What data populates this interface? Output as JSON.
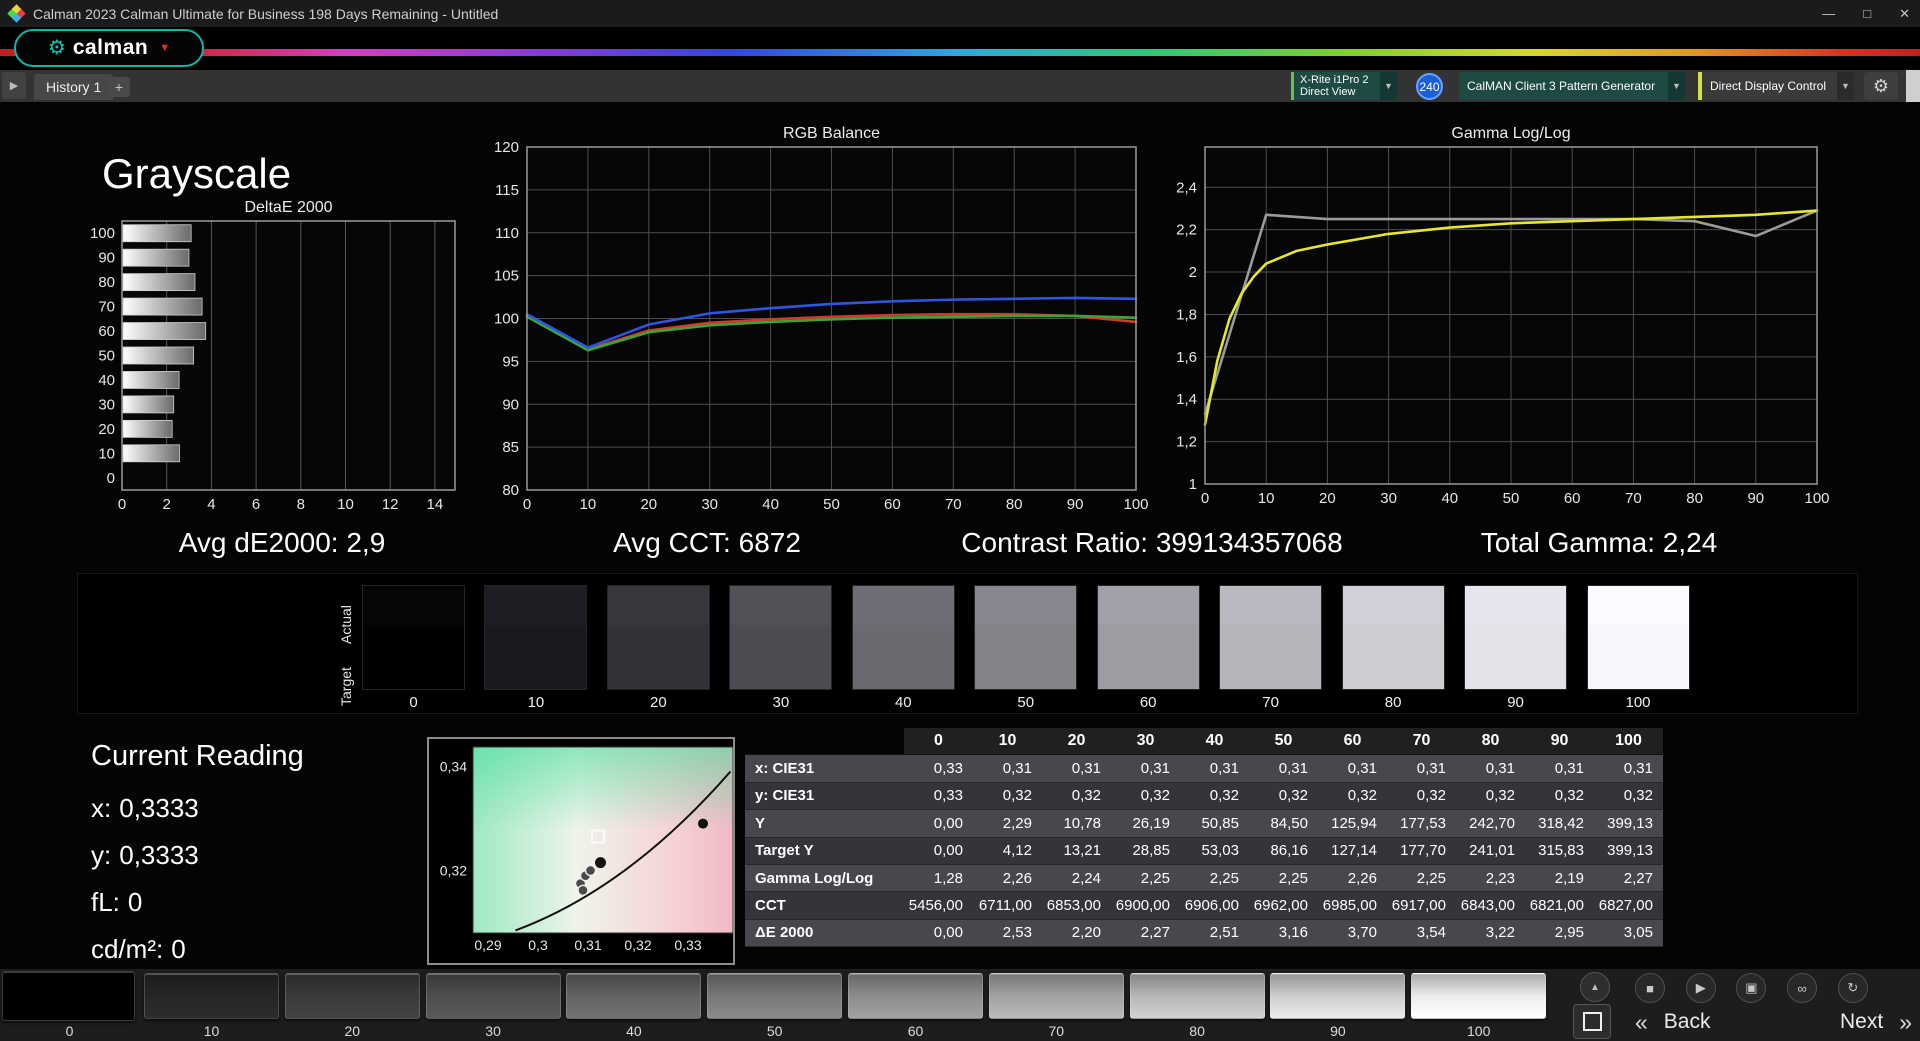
{
  "titlebar": {
    "title": "Calman 2023 Calman Ultimate for Business 198 Days Remaining  - Untitled"
  },
  "icons": {
    "minimize": "—",
    "maximize": "□",
    "close": "✕",
    "caret_down": "▼",
    "plus": "+",
    "nav_expand": "▶",
    "logo_gear": "⚙",
    "logo_caret": "▼",
    "settings_gear": "⚙",
    "collapse_up": "▲",
    "back_chevrons": "«",
    "next_chevrons": "»"
  },
  "header": {
    "brand": "calman"
  },
  "toolbar": {
    "history_tab": "History 1",
    "meter_line1": "X-Rite i1Pro 2",
    "meter_line2": "Direct View",
    "meter_badge": "240",
    "pattern_generator": "CalMAN Client 3 Pattern Generator",
    "display_control": "Direct Display Control"
  },
  "page_title": "Grayscale",
  "stats": [
    {
      "label": "Avg dE2000:",
      "value": "2,9"
    },
    {
      "label": "Avg CCT:",
      "value": "6872"
    },
    {
      "label": "Contrast Ratio:",
      "value": "399134357068"
    },
    {
      "label": "Total Gamma:",
      "value": "2,24"
    }
  ],
  "chart_data": [
    {
      "id": "deltae",
      "type": "bar",
      "orientation": "horizontal",
      "title": "DeltaE 2000",
      "categories": [
        "100",
        "90",
        "80",
        "70",
        "60",
        "50",
        "40",
        "30",
        "20",
        "10",
        "0"
      ],
      "values": [
        3.05,
        2.95,
        3.22,
        3.54,
        3.7,
        3.16,
        2.51,
        2.27,
        2.2,
        2.53,
        0
      ],
      "xlim": [
        0,
        14.9
      ],
      "xticks": [
        0,
        2,
        4,
        6,
        8,
        10,
        12,
        14
      ],
      "xlabel": "",
      "ylabel": ""
    },
    {
      "id": "rgb",
      "type": "line",
      "title": "RGB Balance",
      "x": [
        0,
        10,
        20,
        30,
        40,
        50,
        60,
        70,
        80,
        90,
        100
      ],
      "series": [
        {
          "name": "Red",
          "color": "#cf3a2e",
          "values": [
            100.3,
            96.4,
            98.6,
            99.5,
            99.9,
            100.2,
            100.4,
            100.5,
            100.5,
            100.3,
            99.6
          ]
        },
        {
          "name": "Green",
          "color": "#3aa33a",
          "values": [
            100.2,
            96.3,
            98.4,
            99.2,
            99.6,
            99.9,
            100.1,
            100.2,
            100.3,
            100.3,
            100.1
          ]
        },
        {
          "name": "Blue",
          "color": "#2f55e0",
          "values": [
            100.5,
            96.6,
            99.3,
            100.6,
            101.2,
            101.7,
            102.0,
            102.2,
            102.3,
            102.4,
            102.3
          ]
        }
      ],
      "xlim": [
        0,
        100
      ],
      "xticks": [
        0,
        10,
        20,
        30,
        40,
        50,
        60,
        70,
        80,
        90,
        100
      ],
      "ylim": [
        80,
        120
      ],
      "yticks": [
        80,
        85,
        90,
        95,
        100,
        105,
        110,
        115,
        120
      ],
      "grid": true,
      "legend": "none"
    },
    {
      "id": "gamma",
      "type": "line",
      "title": "Gamma Log/Log",
      "xlim": [
        0,
        100
      ],
      "xticks": [
        0,
        10,
        20,
        30,
        40,
        50,
        60,
        70,
        80,
        90,
        100
      ],
      "ylim": [
        1,
        2.59
      ],
      "yticks": [
        1,
        1.2,
        1.4,
        1.6,
        1.8,
        2,
        2.2,
        2.4
      ],
      "ytick_labels": [
        "1",
        "1,2",
        "1,4",
        "1,6",
        "1,8",
        "2",
        "2,2",
        "2,4"
      ],
      "series": [
        {
          "name": "Target",
          "color": "#9b9b9b",
          "x": [
            0,
            10,
            20,
            30,
            40,
            50,
            60,
            70,
            80,
            90,
            100
          ],
          "values": [
            1.33,
            2.27,
            2.25,
            2.25,
            2.25,
            2.25,
            2.25,
            2.25,
            2.24,
            2.17,
            2.29
          ]
        },
        {
          "name": "Measured",
          "color": "#e6e632",
          "x": [
            0,
            2,
            4,
            6,
            8,
            10,
            15,
            20,
            30,
            40,
            50,
            60,
            70,
            80,
            90,
            100
          ],
          "values": [
            1.28,
            1.58,
            1.78,
            1.9,
            1.98,
            2.04,
            2.1,
            2.13,
            2.18,
            2.21,
            2.23,
            2.24,
            2.25,
            2.26,
            2.27,
            2.29
          ]
        }
      ],
      "grid": true,
      "legend": "none"
    },
    {
      "id": "cie",
      "type": "scatter",
      "title": "CIE chromaticity detail",
      "xlim": [
        0.287,
        0.339
      ],
      "ylim": [
        0.308,
        0.3437
      ],
      "xticks": [
        0.29,
        0.3,
        0.31,
        0.32,
        0.33
      ],
      "xtick_labels": [
        "0,29",
        "0,3",
        "0,31",
        "0,32",
        "0,33"
      ],
      "yticks": [
        0.32,
        0.34
      ],
      "ytick_labels": [
        "0,32",
        "0,34"
      ],
      "locus": [
        [
          0.2955,
          0.3085
        ],
        [
          0.318,
          0.3165
        ],
        [
          0.3385,
          0.339
        ]
      ],
      "points": {
        "readings": [
          [
            0.3085,
            0.3175
          ],
          [
            0.3095,
            0.319
          ],
          [
            0.3105,
            0.32
          ],
          [
            0.309,
            0.3162
          ]
        ],
        "current": [
          0.3125,
          0.3215
        ],
        "reference": [
          0.333,
          0.329
        ],
        "target_square": [
          0.312,
          0.3265
        ]
      }
    }
  ],
  "swatches": {
    "row_labels": [
      "Actual",
      "Target"
    ],
    "levels": [
      "0",
      "10",
      "20",
      "30",
      "40",
      "50",
      "60",
      "70",
      "80",
      "90",
      "100"
    ],
    "actual": [
      "#060608",
      "#1e1e24",
      "#37373e",
      "#515158",
      "#6e6e76",
      "#87878f",
      "#a0a0a8",
      "#b9b9c1",
      "#d0d0d8",
      "#e5e5ed",
      "#fafaff"
    ],
    "target": [
      "#010102",
      "#19191e",
      "#323239",
      "#4c4c53",
      "#6a6a71",
      "#838389",
      "#9c9ca3",
      "#b5b5bc",
      "#cdcdd4",
      "#e2e2e9",
      "#f6f6fb"
    ]
  },
  "current_reading": {
    "title": "Current Reading",
    "items": [
      {
        "label": "x:",
        "value": "0,3333"
      },
      {
        "label": "y:",
        "value": "0,3333"
      },
      {
        "label": "fL:",
        "value": "0"
      },
      {
        "label": "cd/m²:",
        "value": "0"
      }
    ]
  },
  "table": {
    "columns": [
      "0",
      "10",
      "20",
      "30",
      "40",
      "50",
      "60",
      "70",
      "80",
      "90",
      "100"
    ],
    "rows": [
      {
        "label": "x: CIE31",
        "values": [
          "0,33",
          "0,31",
          "0,31",
          "0,31",
          "0,31",
          "0,31",
          "0,31",
          "0,31",
          "0,31",
          "0,31",
          "0,31"
        ]
      },
      {
        "label": "y: CIE31",
        "values": [
          "0,33",
          "0,32",
          "0,32",
          "0,32",
          "0,32",
          "0,32",
          "0,32",
          "0,32",
          "0,32",
          "0,32",
          "0,32"
        ]
      },
      {
        "label": "Y",
        "values": [
          "0,00",
          "2,29",
          "10,78",
          "26,19",
          "50,85",
          "84,50",
          "125,94",
          "177,53",
          "242,70",
          "318,42",
          "399,13"
        ]
      },
      {
        "label": "Target Y",
        "values": [
          "0,00",
          "4,12",
          "13,21",
          "28,85",
          "53,03",
          "86,16",
          "127,14",
          "177,70",
          "241,01",
          "315,83",
          "399,13"
        ]
      },
      {
        "label": "Gamma Log/Log",
        "values": [
          "1,28",
          "2,26",
          "2,24",
          "2,25",
          "2,25",
          "2,25",
          "2,26",
          "2,25",
          "2,23",
          "2,19",
          "2,27"
        ]
      },
      {
        "label": "CCT",
        "values": [
          "5456,00",
          "6711,00",
          "6853,00",
          "6900,00",
          "6906,00",
          "6962,00",
          "6985,00",
          "6917,00",
          "6843,00",
          "6821,00",
          "6827,00"
        ]
      },
      {
        "label": "ΔE 2000",
        "values": [
          "0,00",
          "2,53",
          "2,20",
          "2,27",
          "2,51",
          "3,16",
          "3,70",
          "3,54",
          "3,22",
          "2,95",
          "3,05"
        ]
      }
    ]
  },
  "bottom_bar": {
    "levels": [
      {
        "label": "0",
        "color": "#000000"
      },
      {
        "label": "10",
        "color": "#262626"
      },
      {
        "label": "20",
        "color": "#3a3a3a"
      },
      {
        "label": "30",
        "color": "#4e4e4e"
      },
      {
        "label": "40",
        "color": "#636363"
      },
      {
        "label": "50",
        "color": "#787878"
      },
      {
        "label": "60",
        "color": "#8d8d8d"
      },
      {
        "label": "70",
        "color": "#a2a2a2"
      },
      {
        "label": "80",
        "color": "#b7b7b7"
      },
      {
        "label": "90",
        "color": "#cdcdcd"
      },
      {
        "label": "100",
        "color": "#ececec"
      }
    ],
    "transport": [
      {
        "name": "stop",
        "glyph": "■"
      },
      {
        "name": "play",
        "glyph": "▶"
      },
      {
        "name": "save",
        "glyph": "▣"
      },
      {
        "name": "link",
        "glyph": "∞"
      },
      {
        "name": "refresh",
        "glyph": "↻"
      }
    ],
    "back_label": "Back",
    "next_label": "Next"
  }
}
